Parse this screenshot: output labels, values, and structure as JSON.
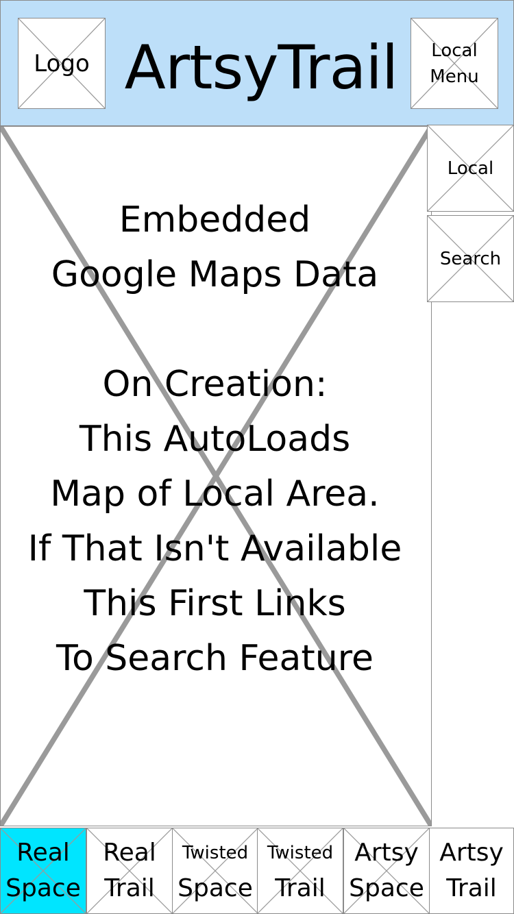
{
  "header": {
    "logo_label": "Logo",
    "app_title": "ArtsyTrail",
    "menu_label_line1": "Local",
    "menu_label_line2": "Menu",
    "background_color": "#bddff9"
  },
  "map": {
    "lines": [
      "Embedded",
      "Google Maps Data",
      "",
      "On Creation:",
      "This AutoLoads",
      "Map of Local Area.",
      "If That Isn't Available",
      "This First Links",
      "To Search Feature"
    ]
  },
  "side_buttons": {
    "local": "Local",
    "search": "Search"
  },
  "tabs": [
    {
      "line1": "Real",
      "line2": "Space",
      "active": true
    },
    {
      "line1": "Real",
      "line2": "Trail",
      "active": false
    },
    {
      "line1": "Twisted",
      "line2": "Space",
      "active": false
    },
    {
      "line1": "Twisted",
      "line2": "Trail",
      "active": false
    },
    {
      "line1": "Artsy",
      "line2": "Space",
      "active": false
    },
    {
      "line1": "Artsy",
      "line2": "Trail",
      "active": false
    }
  ],
  "colors": {
    "active_tab": "#00e5ff",
    "placeholder_border": "#8a8a8a"
  }
}
